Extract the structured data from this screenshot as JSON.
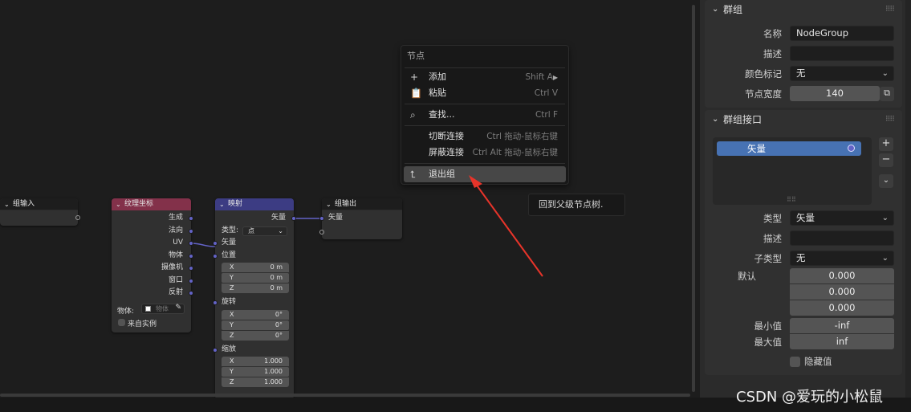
{
  "nodes": {
    "group_input": {
      "title": "组输入"
    },
    "tex_coord": {
      "title": "纹理坐标",
      "outputs": [
        "生成",
        "法向",
        "UV",
        "物体",
        "摄像机",
        "窗口",
        "反射"
      ],
      "object_label": "物体:",
      "object_placeholder": "物体",
      "from_instancer": "来自实例"
    },
    "mapping": {
      "title": "映射",
      "output": "矢量",
      "type_label": "类型:",
      "type_value": "点",
      "vector_label": "矢量",
      "location_label": "位置",
      "location": [
        {
          "k": "X",
          "v": "0 m"
        },
        {
          "k": "Y",
          "v": "0 m"
        },
        {
          "k": "Z",
          "v": "0 m"
        }
      ],
      "rotation_label": "旋转",
      "rotation": [
        {
          "k": "X",
          "v": "0°"
        },
        {
          "k": "Y",
          "v": "0°"
        },
        {
          "k": "Z",
          "v": "0°"
        }
      ],
      "scale_label": "缩放",
      "scale": [
        {
          "k": "X",
          "v": "1.000"
        },
        {
          "k": "Y",
          "v": "1.000"
        },
        {
          "k": "Z",
          "v": "1.000"
        }
      ]
    },
    "group_output": {
      "title": "组输出",
      "input": "矢量"
    }
  },
  "menu": {
    "title": "节点",
    "items": [
      {
        "label": "添加",
        "shortcut": "Shift A",
        "icon": "plus-icon"
      },
      {
        "label": "粘贴",
        "shortcut": "Ctrl V",
        "icon": "paste-icon"
      },
      {
        "label": "查找...",
        "shortcut": "Ctrl F",
        "icon": "search-icon"
      },
      {
        "label": "切断连接",
        "shortcut": "Ctrl 拖动-鼠标右键"
      },
      {
        "label": "屏蔽连接",
        "shortcut": "Ctrl Alt 拖动-鼠标右键"
      },
      {
        "label": "退出组",
        "shortcut": "",
        "icon": "exit-group-icon"
      }
    ]
  },
  "tooltip": "回到父级节点树.",
  "sidebar": {
    "group_panel": {
      "title": "群组",
      "name_label": "名称",
      "name_value": "NodeGroup",
      "desc_label": "描述",
      "desc_value": "",
      "color_label": "颜色标记",
      "color_value": "无",
      "width_label": "节点宽度",
      "width_value": "140"
    },
    "interface_panel": {
      "title": "群组接口",
      "socket_item": "矢量",
      "type_label": "类型",
      "type_value": "矢量",
      "desc_label": "描述",
      "desc_value": "",
      "subtype_label": "子类型",
      "subtype_value": "无",
      "default_label": "默认",
      "default_values": [
        "0.000",
        "0.000",
        "0.000"
      ],
      "min_label": "最小值",
      "min_value": "-inf",
      "max_label": "最大值",
      "max_value": "inf",
      "hide_label": "隐藏值"
    }
  },
  "watermark": "CSDN @爱玩的小松鼠",
  "colors": {
    "texcoord_header": "#83314a",
    "mapping_header": "#3c3c83",
    "group_header": "#1d1d1d",
    "vector_socket": "#6363c7",
    "selected_item": "#4772b3",
    "arrow": "#e8342a"
  }
}
